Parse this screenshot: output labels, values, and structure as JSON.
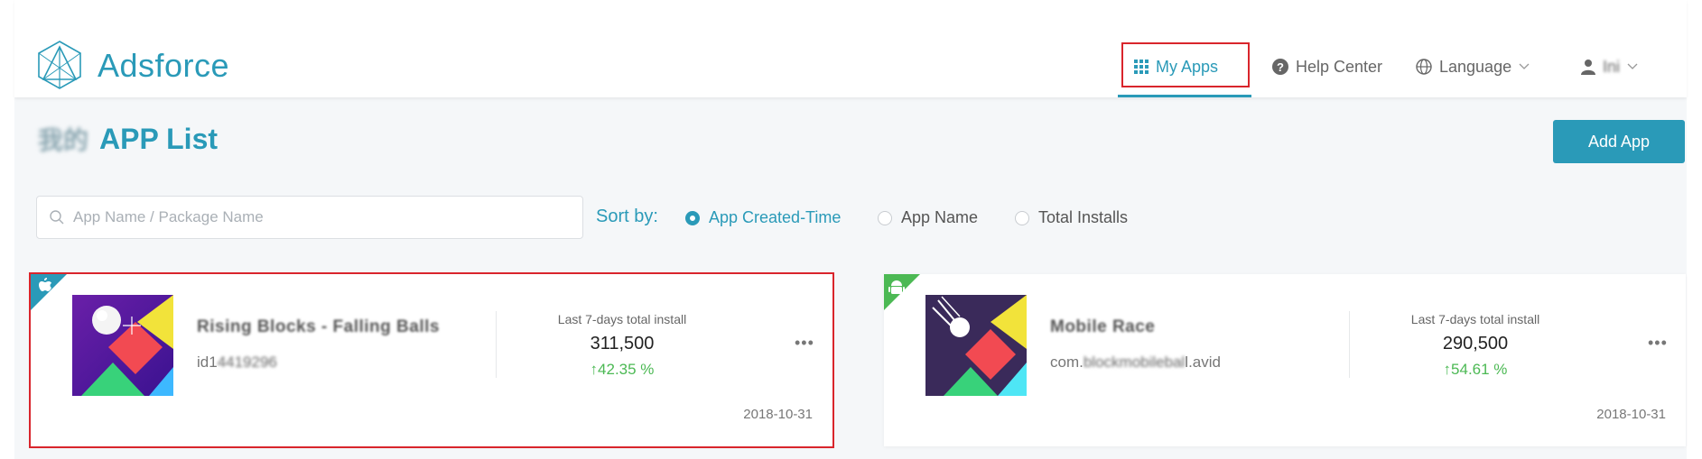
{
  "header": {
    "brand": "Adsforce",
    "nav": {
      "my_apps": "My Apps",
      "help_center": "Help Center",
      "language": "Language",
      "user": "Ini"
    }
  },
  "page": {
    "title_prefix": "我的",
    "title": "APP List",
    "add_app_label": "Add App"
  },
  "search": {
    "placeholder": "App Name / Package Name",
    "value": ""
  },
  "sort": {
    "label": "Sort by:",
    "options": [
      "App Created-Time",
      "App Name",
      "Total Installs"
    ],
    "selected": "App Created-Time"
  },
  "apps": [
    {
      "platform": "ios",
      "name": "Rising Blocks - Falling Balls",
      "id": "id1",
      "id_rest": "4419296",
      "installs_label": "Last 7-days total install",
      "installs": "311,500",
      "growth": "42.35 %",
      "date": "2018-10-31",
      "more": "•••"
    },
    {
      "platform": "android",
      "name": "Mobile Race",
      "id": "com.",
      "id_rest": "blockmobilebal",
      "id_suffix": "l.avid",
      "installs_label": "Last 7-days total install",
      "installs": "290,500",
      "growth": "54.61 %",
      "date": "2018-10-31",
      "more": "•••"
    }
  ],
  "colors": {
    "accent": "#2a9ab8",
    "growth": "#4cb954",
    "highlight": "#d9252c"
  }
}
